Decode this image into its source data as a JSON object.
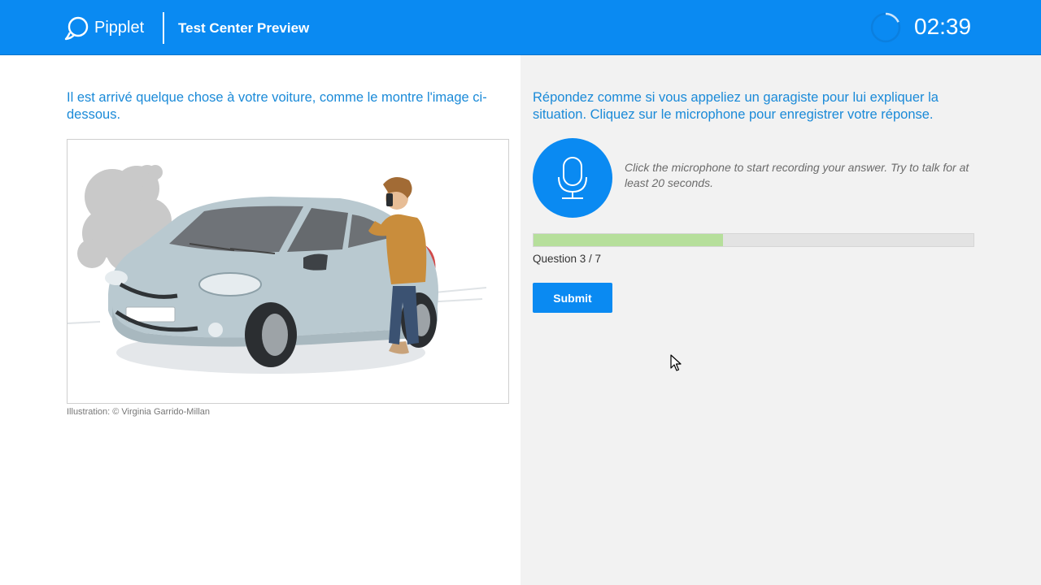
{
  "header": {
    "brand": "Pipplet",
    "title": "Test Center Preview",
    "timer": "02:39",
    "timer_progress": 0.25
  },
  "left": {
    "prompt": "Il est arrivé quelque chose à votre voiture, comme le montre l'image ci-dessous.",
    "caption": "Illustration: © Virginia Garrido-Millan"
  },
  "right": {
    "prompt": "Répondez comme si vous appeliez un garagiste pour lui expliquer la situation. Cliquez sur le microphone pour enregistrer votre réponse.",
    "mic_hint": "Click the microphone to start recording your answer. Try to talk for at least 20 seconds.",
    "progress_fraction": 0.43,
    "question_count": "Question 3 / 7",
    "submit_label": "Submit"
  },
  "colors": {
    "brand_blue": "#0a8af2",
    "prompt_blue": "#1a8ad8",
    "progress_green": "#b6df9b"
  }
}
